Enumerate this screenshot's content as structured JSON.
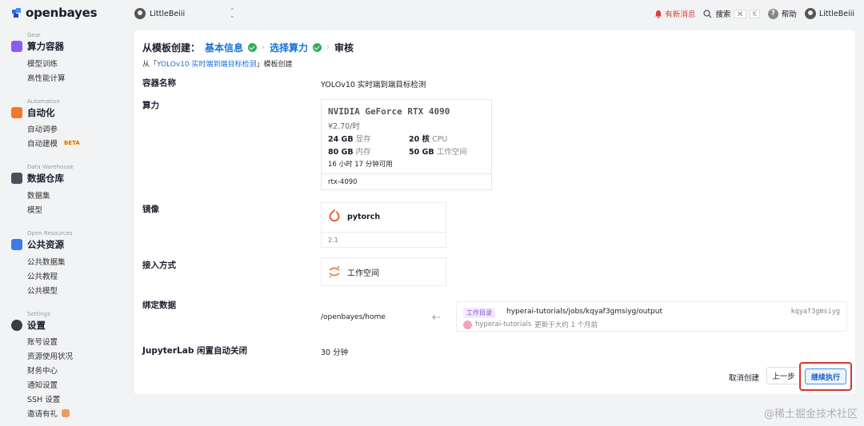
{
  "sidebar": {
    "brand": "openbayes",
    "groups": [
      {
        "label": "Gear",
        "title": "算力容器",
        "items": [
          "模型训练",
          "高性能计算"
        ]
      },
      {
        "label": "Automation",
        "title": "自动化",
        "items": [
          "自动调参",
          "自动建模"
        ]
      },
      {
        "label": "Data Warehouse",
        "title": "数据仓库",
        "items": [
          "数据集",
          "模型"
        ]
      },
      {
        "label": "Open Resources",
        "title": "公共资源",
        "items": [
          "公共数据集",
          "公共教程",
          "公共模型"
        ]
      },
      {
        "label": "Settings",
        "title": "设置",
        "items": [
          "账号设置",
          "资源使用状况",
          "财务中心",
          "通知设置",
          "SSH 设置",
          "邀请有礼"
        ]
      }
    ],
    "beta_badge": "BETA"
  },
  "topbar": {
    "workspace_user": "LittleBeiii",
    "notifications": "有新消息",
    "search_label": "搜索",
    "search_kbd": [
      "⌘",
      "K"
    ],
    "help_label": "帮助",
    "user_name": "LittleBeiii"
  },
  "steps": {
    "prefix": "从模板创建：",
    "step1": "基本信息",
    "step2": "选择算力",
    "step3": "审核"
  },
  "from_line": {
    "before": "从「",
    "template": "YOLOv10 实时端到端目标检测",
    "after": "」模板创建"
  },
  "rows": {
    "container_name_label": "容器名称",
    "container_name_value": "YOLOv10 实时端到端目标检测",
    "compute_label": "算力",
    "image_label": "镜像",
    "access_label": "接入方式",
    "bind_label": "绑定数据",
    "jupyter_label": "JupyterLab 闲置自动关闭",
    "jupyter_value": "30 分钟"
  },
  "gpu": {
    "name": "NVIDIA GeForce RTX 4090",
    "price": "¥2.70/时",
    "vram_value": "24 GB",
    "vram_label": "显存",
    "cpu_value": "20 核",
    "cpu_label": "CPU",
    "mem_value": "80 GB",
    "mem_label": "内存",
    "disk_value": "50 GB",
    "disk_label": "工作空间",
    "available": "16 小时 17 分钟可用",
    "tag": "rtx-4090"
  },
  "image": {
    "name": "pytorch",
    "version": "2.1"
  },
  "access": {
    "mode": "工作空间"
  },
  "binding": {
    "mount_path": "/openbayes/home",
    "tag": "工作目录",
    "source_path": "hyperai-tutorials/jobs/kqyaf3gmsiyg/output",
    "hash": "kqyaf3gmsiyg",
    "owner": "hyperai-tutorials",
    "updated": "更新于大约 1 个月前"
  },
  "actions": {
    "cancel": "取消创建",
    "prev": "上一步",
    "next": "继续执行"
  },
  "watermark": "@稀土掘金技术社区",
  "colors": {
    "accent": "#1a72d8",
    "success": "#2bb05a",
    "danger": "#d9342b"
  }
}
